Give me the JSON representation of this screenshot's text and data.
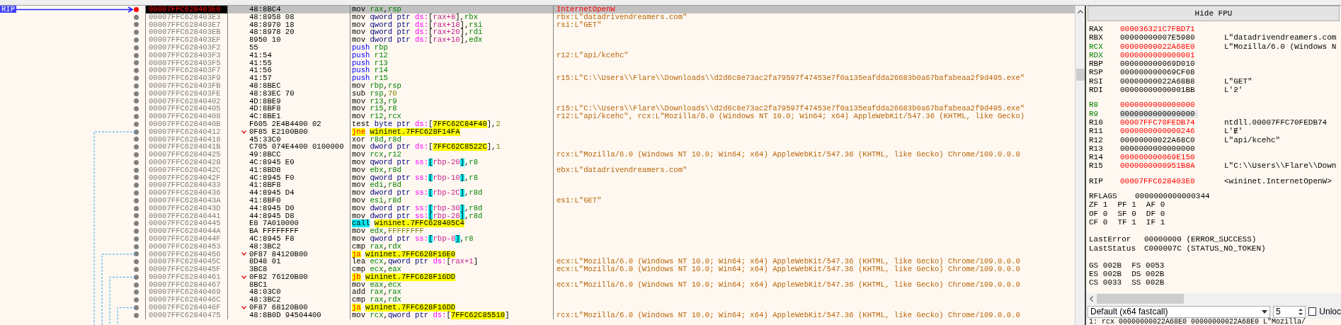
{
  "disassembly": {
    "rip_label": "RIP",
    "rows": [
      {
        "address": "00007FFC628403E0",
        "bytes": "48:8BC4",
        "selected": true,
        "breakpoint": true,
        "jump": false,
        "instruction": [
          {
            "text": "mov",
            "kind": "op"
          },
          {
            "text": "rax",
            "kind": "reg"
          },
          {
            "text": ",",
            "kind": "sep"
          },
          {
            "text": "rsp",
            "kind": "reg"
          }
        ],
        "comment": {
          "text": "InternetOpenW",
          "kind": "label"
        }
      },
      {
        "address": "00007FFC628403E3",
        "bytes": "48:8958 08",
        "selected": false,
        "breakpoint": false,
        "jump": false,
        "instruction": [
          {
            "text": "mov",
            "kind": "op"
          },
          {
            "text": "qword ptr",
            "kind": "size"
          },
          {
            "text": "ds:",
            "kind": "seg"
          },
          {
            "text": "[",
            "kind": "br"
          },
          {
            "text": "rax+8",
            "kind": "mem"
          },
          {
            "text": "]",
            "kind": "br"
          },
          {
            "text": ",",
            "kind": "sep"
          },
          {
            "text": "rbx",
            "kind": "reg"
          }
        ],
        "comment": {
          "text": "rbx:L\"datadrivendreamers.com\"",
          "kind": "string"
        }
      },
      {
        "address": "00007FFC628403E7",
        "bytes": "48:8970 18",
        "selected": false,
        "breakpoint": false,
        "jump": false,
        "instruction": [
          {
            "text": "mov",
            "kind": "op"
          },
          {
            "text": "qword ptr",
            "kind": "size"
          },
          {
            "text": "ds:",
            "kind": "seg"
          },
          {
            "text": "[",
            "kind": "br"
          },
          {
            "text": "rax+18",
            "kind": "mem"
          },
          {
            "text": "]",
            "kind": "br"
          },
          {
            "text": ",",
            "kind": "sep"
          },
          {
            "text": "rsi",
            "kind": "reg"
          }
        ],
        "comment": {
          "text": "rsi:L\"GET\"",
          "kind": "string"
        }
      },
      {
        "address": "00007FFC628403EB",
        "bytes": "48:8978 20",
        "selected": false,
        "breakpoint": false,
        "jump": false,
        "instruction": [
          {
            "text": "mov",
            "kind": "op"
          },
          {
            "text": "qword ptr",
            "kind": "size"
          },
          {
            "text": "ds:",
            "kind": "seg"
          },
          {
            "text": "[",
            "kind": "br"
          },
          {
            "text": "rax+20",
            "kind": "mem"
          },
          {
            "text": "]",
            "kind": "br"
          },
          {
            "text": ",",
            "kind": "sep"
          },
          {
            "text": "rdi",
            "kind": "reg"
          }
        ]
      },
      {
        "address": "00007FFC628403EF",
        "bytes": "8950 10",
        "selected": false,
        "breakpoint": false,
        "jump": false,
        "instruction": [
          {
            "text": "mov",
            "kind": "op"
          },
          {
            "text": "dword ptr",
            "kind": "size"
          },
          {
            "text": "ds:",
            "kind": "seg"
          },
          {
            "text": "[",
            "kind": "br"
          },
          {
            "text": "rax+10",
            "kind": "mem"
          },
          {
            "text": "]",
            "kind": "br"
          },
          {
            "text": ",",
            "kind": "sep"
          },
          {
            "text": "edx",
            "kind": "reg"
          }
        ]
      },
      {
        "address": "00007FFC628403F2",
        "bytes": "55",
        "selected": false,
        "breakpoint": false,
        "jump": false,
        "instruction": [
          {
            "text": "push",
            "kind": "push"
          },
          {
            "text": "rbp",
            "kind": "reg"
          }
        ]
      },
      {
        "address": "00007FFC628403F3",
        "bytes": "41:54",
        "selected": false,
        "breakpoint": false,
        "jump": false,
        "instruction": [
          {
            "text": "push",
            "kind": "push"
          },
          {
            "text": "r12",
            "kind": "reg"
          }
        ],
        "comment": {
          "text": "r12:L\"api/kcehc\"",
          "kind": "string"
        }
      },
      {
        "address": "00007FFC628403F5",
        "bytes": "41:55",
        "selected": false,
        "breakpoint": false,
        "jump": false,
        "instruction": [
          {
            "text": "push",
            "kind": "push"
          },
          {
            "text": "r13",
            "kind": "reg"
          }
        ]
      },
      {
        "address": "00007FFC628403F7",
        "bytes": "41:56",
        "selected": false,
        "breakpoint": false,
        "jump": false,
        "instruction": [
          {
            "text": "push",
            "kind": "push"
          },
          {
            "text": "r14",
            "kind": "reg"
          }
        ]
      },
      {
        "address": "00007FFC628403F9",
        "bytes": "41:57",
        "selected": false,
        "breakpoint": false,
        "jump": false,
        "instruction": [
          {
            "text": "push",
            "kind": "push"
          },
          {
            "text": "r15",
            "kind": "reg"
          }
        ],
        "comment": {
          "text": "r15:L\"C:\\\\Users\\\\Flare\\\\Downloads\\\\d2d6c8e73ac2fa79597f47453e7f0a135eafdda26683b0a67bafabeaa2f9d495.exe\"",
          "kind": "string"
        }
      },
      {
        "address": "00007FFC628403FB",
        "bytes": "48:8BEC",
        "selected": false,
        "breakpoint": false,
        "jump": false,
        "instruction": [
          {
            "text": "mov",
            "kind": "op"
          },
          {
            "text": "rbp",
            "kind": "reg"
          },
          {
            "text": ",",
            "kind": "sep"
          },
          {
            "text": "rsp",
            "kind": "reg"
          }
        ]
      },
      {
        "address": "00007FFC628403FE",
        "bytes": "48:83EC 70",
        "selected": false,
        "breakpoint": false,
        "jump": false,
        "instruction": [
          {
            "text": "sub",
            "kind": "op"
          },
          {
            "text": "rsp",
            "kind": "reg"
          },
          {
            "text": ",",
            "kind": "sep"
          },
          {
            "text": "70",
            "kind": "num"
          }
        ]
      },
      {
        "address": "00007FFC62840402",
        "bytes": "4D:8BE9",
        "selected": false,
        "breakpoint": false,
        "jump": false,
        "instruction": [
          {
            "text": "mov",
            "kind": "op"
          },
          {
            "text": "r13",
            "kind": "reg"
          },
          {
            "text": ",",
            "kind": "sep"
          },
          {
            "text": "r9",
            "kind": "reg"
          }
        ]
      },
      {
        "address": "00007FFC62840405",
        "bytes": "4D:8BF8",
        "selected": false,
        "breakpoint": false,
        "jump": false,
        "instruction": [
          {
            "text": "mov",
            "kind": "op"
          },
          {
            "text": "r15",
            "kind": "reg"
          },
          {
            "text": ",",
            "kind": "sep"
          },
          {
            "text": "r8",
            "kind": "reg"
          }
        ],
        "comment": {
          "text": "r15:L\"C:\\\\Users\\\\Flare\\\\Downloads\\\\d2d6c8e73ac2fa79597f47453e7f0a135eafdda26683b0a67bafabeaa2f9d495.exe\"",
          "kind": "string"
        }
      },
      {
        "address": "00007FFC62840408",
        "bytes": "4C:8BE1",
        "selected": false,
        "breakpoint": false,
        "jump": false,
        "instruction": [
          {
            "text": "mov",
            "kind": "op"
          },
          {
            "text": "r12",
            "kind": "reg"
          },
          {
            "text": ",",
            "kind": "sep"
          },
          {
            "text": "rcx",
            "kind": "reg"
          }
        ],
        "comment": {
          "text": "r12:L\"api/kcehc\", rcx:L\"Mozilla/6.0 (Windows NT 10.0; Win64; x64) AppleWebKit/547.36 (KHTML, like Gecko)",
          "kind": "string"
        }
      },
      {
        "address": "00007FFC6284040B",
        "bytes": "F605 2E4B4400 02",
        "selected": false,
        "breakpoint": false,
        "jump": false,
        "instruction": [
          {
            "text": "test",
            "kind": "op"
          },
          {
            "text": "byte ptr",
            "kind": "size"
          },
          {
            "text": "ds:",
            "kind": "seg"
          },
          {
            "text": "[",
            "kind": "br"
          },
          {
            "text": "7FFC62C84F40",
            "kind": "addr"
          },
          {
            "text": "]",
            "kind": "br"
          },
          {
            "text": ",",
            "kind": "sep"
          },
          {
            "text": "2",
            "kind": "num"
          }
        ]
      },
      {
        "address": "00007FFC62840412",
        "bytes": "0F85 E2100B00",
        "selected": false,
        "breakpoint": false,
        "jump": true,
        "instruction": [
          {
            "text": "jne",
            "kind": "jcc"
          },
          {
            "text": "wininet.7FFC628F14FA",
            "kind": "target"
          }
        ]
      },
      {
        "address": "00007FFC62840418",
        "bytes": "45:33C0",
        "selected": false,
        "breakpoint": false,
        "jump": false,
        "instruction": [
          {
            "text": "xor",
            "kind": "op"
          },
          {
            "text": "r8d",
            "kind": "reg"
          },
          {
            "text": ",",
            "kind": "sep"
          },
          {
            "text": "r8d",
            "kind": "reg"
          }
        ]
      },
      {
        "address": "00007FFC6284041B",
        "bytes": "C705 074E4400 0100000",
        "selected": false,
        "breakpoint": false,
        "jump": false,
        "instruction": [
          {
            "text": "mov",
            "kind": "op"
          },
          {
            "text": "dword ptr",
            "kind": "size"
          },
          {
            "text": "ds:",
            "kind": "seg"
          },
          {
            "text": "[",
            "kind": "br"
          },
          {
            "text": "7FFC62C8522C",
            "kind": "addr"
          },
          {
            "text": "]",
            "kind": "br"
          },
          {
            "text": ",",
            "kind": "sep"
          },
          {
            "text": "1",
            "kind": "num"
          }
        ]
      },
      {
        "address": "00007FFC62840425",
        "bytes": "49:8BCC",
        "selected": false,
        "breakpoint": false,
        "jump": false,
        "instruction": [
          {
            "text": "mov",
            "kind": "op"
          },
          {
            "text": "rcx",
            "kind": "reg"
          },
          {
            "text": ",",
            "kind": "sep"
          },
          {
            "text": "r12",
            "kind": "reg"
          }
        ],
        "comment": {
          "text": "rcx:L\"Mozilla/6.0 (Windows NT 10.0; Win64; x64) AppleWebKit/547.36 (KHTML, like Gecko) Chrome/109.0.0.0",
          "kind": "string"
        }
      },
      {
        "address": "00007FFC62840428",
        "bytes": "4C:8945 E0",
        "selected": false,
        "breakpoint": false,
        "jump": false,
        "instruction": [
          {
            "text": "mov",
            "kind": "op"
          },
          {
            "text": "qword ptr",
            "kind": "size"
          },
          {
            "text": "ss:",
            "kind": "seg"
          },
          {
            "text": "[",
            "kind": "sbr"
          },
          {
            "text": "rbp-20",
            "kind": "mem"
          },
          {
            "text": "]",
            "kind": "sbr"
          },
          {
            "text": ",",
            "kind": "sep"
          },
          {
            "text": "r8",
            "kind": "reg"
          }
        ]
      },
      {
        "address": "00007FFC6284042C",
        "bytes": "41:8BD8",
        "selected": false,
        "breakpoint": false,
        "jump": false,
        "instruction": [
          {
            "text": "mov",
            "kind": "op"
          },
          {
            "text": "ebx",
            "kind": "reg"
          },
          {
            "text": ",",
            "kind": "sep"
          },
          {
            "text": "r8d",
            "kind": "reg"
          }
        ],
        "comment": {
          "text": "ebx:L\"datadrivendreamers.com\"",
          "kind": "string"
        }
      },
      {
        "address": "00007FFC6284042F",
        "bytes": "4C:8945 F0",
        "selected": false,
        "breakpoint": false,
        "jump": false,
        "instruction": [
          {
            "text": "mov",
            "kind": "op"
          },
          {
            "text": "qword ptr",
            "kind": "size"
          },
          {
            "text": "ss:",
            "kind": "seg"
          },
          {
            "text": "[",
            "kind": "sbr"
          },
          {
            "text": "rbp-10",
            "kind": "mem"
          },
          {
            "text": "]",
            "kind": "sbr"
          },
          {
            "text": ",",
            "kind": "sep"
          },
          {
            "text": "r8",
            "kind": "reg"
          }
        ]
      },
      {
        "address": "00007FFC62840433",
        "bytes": "41:8BF8",
        "selected": false,
        "breakpoint": false,
        "jump": false,
        "instruction": [
          {
            "text": "mov",
            "kind": "op"
          },
          {
            "text": "edi",
            "kind": "reg"
          },
          {
            "text": ",",
            "kind": "sep"
          },
          {
            "text": "r8d",
            "kind": "reg"
          }
        ]
      },
      {
        "address": "00007FFC62840436",
        "bytes": "44:8945 D4",
        "selected": false,
        "breakpoint": false,
        "jump": false,
        "instruction": [
          {
            "text": "mov",
            "kind": "op"
          },
          {
            "text": "dword ptr",
            "kind": "size"
          },
          {
            "text": "ss:",
            "kind": "seg"
          },
          {
            "text": "[",
            "kind": "sbr"
          },
          {
            "text": "rbp-2C",
            "kind": "mem"
          },
          {
            "text": "]",
            "kind": "sbr"
          },
          {
            "text": ",",
            "kind": "sep"
          },
          {
            "text": "r8d",
            "kind": "reg"
          }
        ]
      },
      {
        "address": "00007FFC6284043A",
        "bytes": "41:8BF0",
        "selected": false,
        "breakpoint": false,
        "jump": false,
        "instruction": [
          {
            "text": "mov",
            "kind": "op"
          },
          {
            "text": "esi",
            "kind": "reg"
          },
          {
            "text": ",",
            "kind": "sep"
          },
          {
            "text": "r8d",
            "kind": "reg"
          }
        ],
        "comment": {
          "text": "esi:L\"GET\"",
          "kind": "string"
        }
      },
      {
        "address": "00007FFC6284043D",
        "bytes": "44:8945 D0",
        "selected": false,
        "breakpoint": false,
        "jump": false,
        "instruction": [
          {
            "text": "mov",
            "kind": "op"
          },
          {
            "text": "dword ptr",
            "kind": "size"
          },
          {
            "text": "ss:",
            "kind": "seg"
          },
          {
            "text": "[",
            "kind": "sbr"
          },
          {
            "text": "rbp-30",
            "kind": "mem"
          },
          {
            "text": "]",
            "kind": "sbr"
          },
          {
            "text": ",",
            "kind": "sep"
          },
          {
            "text": "r8d",
            "kind": "reg"
          }
        ]
      },
      {
        "address": "00007FFC62840441",
        "bytes": "44:8945 D8",
        "selected": false,
        "breakpoint": false,
        "jump": false,
        "instruction": [
          {
            "text": "mov",
            "kind": "op"
          },
          {
            "text": "dword ptr",
            "kind": "size"
          },
          {
            "text": "ss:",
            "kind": "seg"
          },
          {
            "text": "[",
            "kind": "sbr"
          },
          {
            "text": "rbp-28",
            "kind": "mem"
          },
          {
            "text": "]",
            "kind": "sbr"
          },
          {
            "text": ",",
            "kind": "sep"
          },
          {
            "text": "r8d",
            "kind": "reg"
          }
        ]
      },
      {
        "address": "00007FFC62840445",
        "bytes": "E8 7A010000",
        "selected": false,
        "breakpoint": false,
        "jump": false,
        "instruction": [
          {
            "text": "call",
            "kind": "call"
          },
          {
            "text": "wininet.7FFC628405C4",
            "kind": "target"
          }
        ]
      },
      {
        "address": "00007FFC6284044A",
        "bytes": "BA FFFFFFFF",
        "selected": false,
        "breakpoint": false,
        "jump": false,
        "instruction": [
          {
            "text": "mov",
            "kind": "op"
          },
          {
            "text": "edx",
            "kind": "reg"
          },
          {
            "text": ",",
            "kind": "sep"
          },
          {
            "text": "FFFFFFFF",
            "kind": "num"
          }
        ]
      },
      {
        "address": "00007FFC6284044F",
        "bytes": "4C:8945 F8",
        "selected": false,
        "breakpoint": false,
        "jump": false,
        "instruction": [
          {
            "text": "mov",
            "kind": "op"
          },
          {
            "text": "qword ptr",
            "kind": "size"
          },
          {
            "text": "ss:",
            "kind": "seg"
          },
          {
            "text": "[",
            "kind": "sbr"
          },
          {
            "text": "rbp-8",
            "kind": "mem"
          },
          {
            "text": "]",
            "kind": "sbr"
          },
          {
            "text": ",",
            "kind": "sep"
          },
          {
            "text": "r8",
            "kind": "reg"
          }
        ]
      },
      {
        "address": "00007FFC62840453",
        "bytes": "48:3BC2",
        "selected": false,
        "breakpoint": false,
        "jump": false,
        "instruction": [
          {
            "text": "cmp",
            "kind": "op"
          },
          {
            "text": "rax",
            "kind": "reg"
          },
          {
            "text": ",",
            "kind": "sep"
          },
          {
            "text": "rdx",
            "kind": "reg"
          }
        ]
      },
      {
        "address": "00007FFC62840456",
        "bytes": "0F87 84120B00",
        "selected": false,
        "breakpoint": false,
        "jump": true,
        "instruction": [
          {
            "text": "ja",
            "kind": "jcc"
          },
          {
            "text": "wininet.7FFC628F16E0",
            "kind": "target"
          }
        ]
      },
      {
        "address": "00007FFC6284045C",
        "bytes": "8D48 01",
        "selected": false,
        "breakpoint": false,
        "jump": false,
        "instruction": [
          {
            "text": "lea",
            "kind": "op"
          },
          {
            "text": "ecx",
            "kind": "reg"
          },
          {
            "text": ",",
            "kind": "sep"
          },
          {
            "text": "qword ptr",
            "kind": "size"
          },
          {
            "text": "ds:",
            "kind": "seg"
          },
          {
            "text": "[",
            "kind": "br"
          },
          {
            "text": "rax+1",
            "kind": "mem"
          },
          {
            "text": "]",
            "kind": "br"
          }
        ],
        "comment": {
          "text": "ecx:L\"Mozilla/6.0 (Windows NT 10.0; Win64; x64) AppleWebKit/547.36 (KHTML, like Gecko) Chrome/109.0.0.0",
          "kind": "string"
        }
      },
      {
        "address": "00007FFC6284045F",
        "bytes": "3BC8",
        "selected": false,
        "breakpoint": false,
        "jump": false,
        "instruction": [
          {
            "text": "cmp",
            "kind": "op"
          },
          {
            "text": "ecx",
            "kind": "reg"
          },
          {
            "text": ",",
            "kind": "sep"
          },
          {
            "text": "eax",
            "kind": "reg"
          }
        ],
        "comment": {
          "text": "ecx:L\"Mozilla/6.0 (Windows NT 10.0; Win64; x64) AppleWebKit/547.36 (KHTML, like Gecko) Chrome/109.0.0.0",
          "kind": "string"
        }
      },
      {
        "address": "00007FFC62840461",
        "bytes": "0F82 76120B00",
        "selected": false,
        "breakpoint": false,
        "jump": true,
        "instruction": [
          {
            "text": "jb",
            "kind": "jcc"
          },
          {
            "text": "wininet.7FFC628F16DD",
            "kind": "target"
          }
        ]
      },
      {
        "address": "00007FFC62840467",
        "bytes": "8BC1",
        "selected": false,
        "breakpoint": false,
        "jump": false,
        "instruction": [
          {
            "text": "mov",
            "kind": "op"
          },
          {
            "text": "eax",
            "kind": "reg"
          },
          {
            "text": ",",
            "kind": "sep"
          },
          {
            "text": "ecx",
            "kind": "reg"
          }
        ],
        "comment": {
          "text": "ecx:L\"Mozilla/6.0 (Windows NT 10.0; Win64; x64) AppleWebKit/547.36 (KHTML, like Gecko) Chrome/109.0.0.0",
          "kind": "string"
        }
      },
      {
        "address": "00007FFC62840469",
        "bytes": "48:03C0",
        "selected": false,
        "breakpoint": false,
        "jump": false,
        "instruction": [
          {
            "text": "add",
            "kind": "op"
          },
          {
            "text": "rax",
            "kind": "reg"
          },
          {
            "text": ",",
            "kind": "sep"
          },
          {
            "text": "rax",
            "kind": "reg"
          }
        ]
      },
      {
        "address": "00007FFC6284046C",
        "bytes": "48:3BC2",
        "selected": false,
        "breakpoint": false,
        "jump": false,
        "instruction": [
          {
            "text": "cmp",
            "kind": "op"
          },
          {
            "text": "rax",
            "kind": "reg"
          },
          {
            "text": ",",
            "kind": "sep"
          },
          {
            "text": "rdx",
            "kind": "reg"
          }
        ]
      },
      {
        "address": "00007FFC6284046F",
        "bytes": "0F87 68120B00",
        "selected": false,
        "breakpoint": false,
        "jump": true,
        "instruction": [
          {
            "text": "ja",
            "kind": "jcc"
          },
          {
            "text": "wininet.7FFC628F16DD",
            "kind": "target"
          }
        ]
      },
      {
        "address": "00007FFC62840475",
        "bytes": "48:8B0D 94504400",
        "selected": false,
        "breakpoint": false,
        "jump": false,
        "instruction": [
          {
            "text": "mov",
            "kind": "op"
          },
          {
            "text": "rcx",
            "kind": "reg"
          },
          {
            "text": ",",
            "kind": "sep"
          },
          {
            "text": "qword ptr",
            "kind": "size"
          },
          {
            "text": "ds:",
            "kind": "seg"
          },
          {
            "text": "[",
            "kind": "br"
          },
          {
            "text": "7FFC62C85510",
            "kind": "addr"
          },
          {
            "text": "]",
            "kind": "br"
          }
        ],
        "comment": {
          "text": "rcx:L\"Mozilla/6.0 (Windows NT 10.0; Win64; x64) AppleWebKit/547.36 (KHTML, like Gecko) Chrome/109.0.0.0",
          "kind": "string"
        }
      }
    ]
  },
  "registers": {
    "hide_fpu_button": "Hide FPU",
    "groups": [
      [
        {
          "name": "RAX",
          "value": "000036321C7FBD71",
          "changed": true,
          "arg": false,
          "selected": false
        },
        {
          "name": "RBX",
          "value": "00000000007E5980",
          "comment": "L\"datadrivendreamers.com",
          "changed": false,
          "arg": false,
          "selected": false
        },
        {
          "name": "RCX",
          "value": "00000000022A68E0",
          "comment": "L\"Mozilla/6.0 (Windows N",
          "changed": true,
          "arg": true,
          "selected": false
        },
        {
          "name": "RDX",
          "value": "0000000000000001",
          "changed": true,
          "arg": true,
          "selected": false
        },
        {
          "name": "RBP",
          "value": "000000000069D010",
          "changed": false,
          "arg": false,
          "selected": false
        },
        {
          "name": "RSP",
          "value": "000000000069CF08",
          "changed": false,
          "arg": false,
          "selected": false
        },
        {
          "name": "RSI",
          "value": "00000000022A68B8",
          "comment": "L\"GET\"",
          "changed": false,
          "arg": false,
          "selected": false
        },
        {
          "name": "RDI",
          "value": "00000000000001BB",
          "comment": "L'ƻ'",
          "changed": false,
          "arg": false,
          "selected": false
        }
      ],
      [
        {
          "name": "R8",
          "value": "0000000000000000",
          "changed": true,
          "arg": true,
          "selected": false
        },
        {
          "name": "R9",
          "value": "0000000000000000",
          "changed": false,
          "arg": true,
          "selected": true
        },
        {
          "name": "R10",
          "value": "00007FFC70FEDB74",
          "comment": "ntdll.00007FFC70FEDB74",
          "changed": true,
          "arg": false,
          "selected": false
        },
        {
          "name": "R11",
          "value": "0000000000000246",
          "comment": "L'Ɇ'",
          "changed": true,
          "arg": false,
          "selected": false
        },
        {
          "name": "R12",
          "value": "00000000022A68C0",
          "comment": "L\"api/kcehc\"",
          "changed": false,
          "arg": false,
          "selected": false
        },
        {
          "name": "R13",
          "value": "0000000000000000",
          "changed": false,
          "arg": false,
          "selected": false
        },
        {
          "name": "R14",
          "value": "000000000069E150",
          "changed": true,
          "arg": false,
          "selected": false
        },
        {
          "name": "R15",
          "value": "0000000000951B8A",
          "comment": "L\"C:\\\\Users\\\\Flare\\\\Down",
          "changed": true,
          "arg": false,
          "selected": false
        }
      ],
      [
        {
          "name": "RIP",
          "value": "00007FFC628403E0",
          "comment": "<wininet.InternetOpenW>",
          "changed": true,
          "arg": false,
          "selected": false
        }
      ]
    ],
    "rflags": {
      "name": "RFLAGS",
      "value": "0000000000000344"
    },
    "flags": [
      [
        {
          "name": "ZF",
          "value": "1"
        },
        {
          "name": "PF",
          "value": "1"
        },
        {
          "name": "AF",
          "value": "0"
        }
      ],
      [
        {
          "name": "OF",
          "value": "0"
        },
        {
          "name": "SF",
          "value": "0"
        },
        {
          "name": "DF",
          "value": "0"
        }
      ],
      [
        {
          "name": "CF",
          "value": "0"
        },
        {
          "name": "TF",
          "value": "1"
        },
        {
          "name": "IF",
          "value": "1"
        }
      ]
    ],
    "last": [
      {
        "name": "LastError",
        "value": "00000000 (ERROR_SUCCESS)"
      },
      {
        "name": "LastStatus",
        "value": "C000007C (STATUS_NO_TOKEN)"
      }
    ],
    "segments": [
      [
        {
          "name": "GS",
          "value": "002B"
        },
        {
          "name": "FS",
          "value": "0053"
        }
      ],
      [
        {
          "name": "ES",
          "value": "002B"
        },
        {
          "name": "DS",
          "value": "002B"
        }
      ],
      [
        {
          "name": "CS",
          "value": "0033"
        },
        {
          "name": "SS",
          "value": "002B"
        }
      ]
    ]
  },
  "call_convention": {
    "value": "Default (x64 fastcall)"
  },
  "arg_count": {
    "value": "5"
  },
  "unlock_checkbox": {
    "label": "Unloc",
    "checked": false
  },
  "call_args": [
    "1: rcx 00000000022A68E0 00000000022A68E0 L\"Mozilla/"
  ]
}
